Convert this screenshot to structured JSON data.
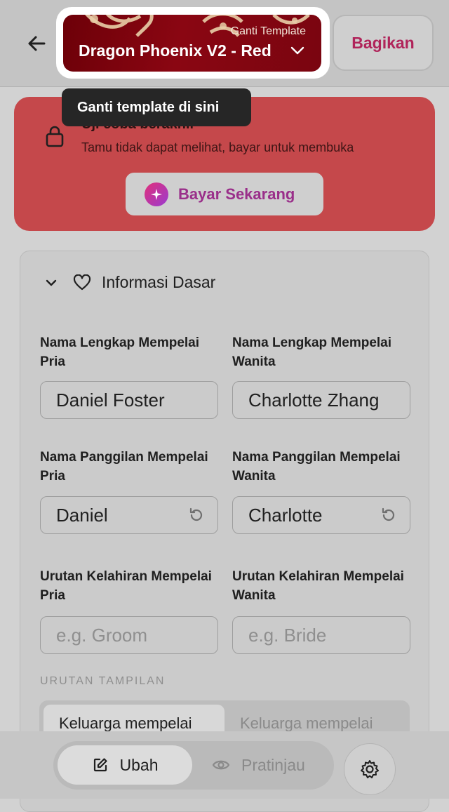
{
  "header": {
    "template_caption": "Ganti Template",
    "template_name": "Dragon Phoenix V2 - Red",
    "share_label": "Bagikan"
  },
  "tooltip": {
    "text": "Ganti template di sini"
  },
  "trial": {
    "title": "Uji coba berakhir",
    "description": "Tamu tidak dapat melihat, bayar untuk membuka",
    "pay_label": "Bayar Sekarang"
  },
  "section": {
    "title": "Informasi Dasar"
  },
  "form": {
    "groom_full_name_label": "Nama Lengkap Mempelai Pria",
    "bride_full_name_label": "Nama Lengkap Mempelai Wanita",
    "groom_full_name_value": "Daniel Foster",
    "bride_full_name_value": "Charlotte Zhang",
    "groom_nickname_label": "Nama Panggilan Mempelai Pria",
    "bride_nickname_label": "Nama Panggilan Mempelai Wanita",
    "groom_nickname_value": "Daniel",
    "bride_nickname_value": "Charlotte",
    "groom_birth_order_label": "Urutan Kelahiran Mempelai Pria",
    "bride_birth_order_label": "Urutan Kelahiran Mempelai Wanita",
    "groom_birth_order_placeholder": "e.g. Groom",
    "bride_birth_order_placeholder": "e.g. Bride"
  },
  "display_order": {
    "label": "URUTAN TAMPILAN",
    "option1": "Keluarga mempelai",
    "option2": "Keluarga mempelai"
  },
  "bottom_bar": {
    "edit_label": "Ubah",
    "preview_label": "Pratinjau"
  },
  "colors": {
    "share_text": "#b0245a",
    "trial_bg": "#c5484b",
    "template_bg": "#7a0510",
    "tooltip_bg": "#262626"
  }
}
